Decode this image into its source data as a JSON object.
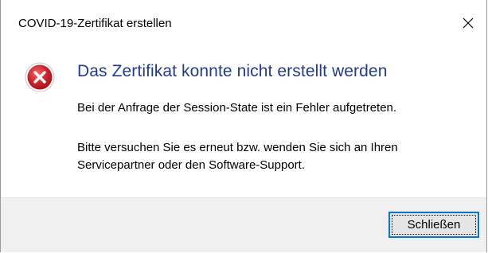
{
  "window": {
    "title": "COVID-19-Zertifikat erstellen",
    "close_icon": "close-icon"
  },
  "content": {
    "icon": "error-icon",
    "heading": "Das Zertifikat konnte nicht erstellt werden",
    "message_1": "Bei der Anfrage der Session-State ist ein Fehler aufgetreten.",
    "message_2_line_1": "Bitte versuchen Sie es erneut bzw. wenden Sie sich an Ihren",
    "message_2_line_2": "Servicepartner oder den Software-Support."
  },
  "footer": {
    "close_button_label": "Schließen"
  },
  "colors": {
    "heading": "#1f3b99",
    "error_red": "#d0232b",
    "button_focus": "#0078d7",
    "footer_bg": "#f0f0f0"
  }
}
